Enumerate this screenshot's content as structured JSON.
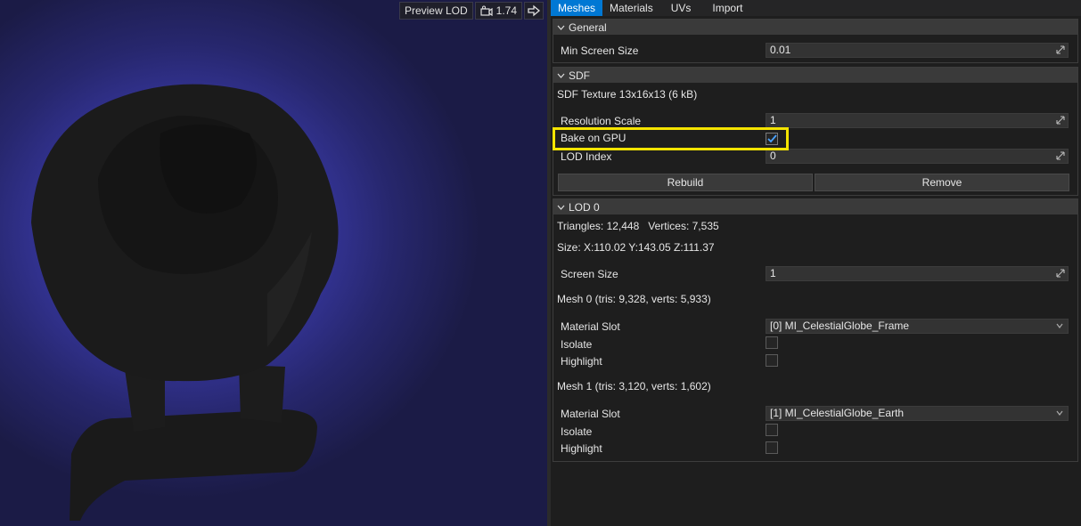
{
  "viewport": {
    "preview_lod_label": "Preview LOD",
    "view_speed": "1.74",
    "colors": {
      "glow": "#3c3cb0",
      "mesh": "#1a1a1a"
    }
  },
  "tabs": [
    {
      "label": "Meshes",
      "active": true
    },
    {
      "label": "Materials",
      "active": false
    },
    {
      "label": "UVs",
      "active": false
    },
    {
      "label": "Import",
      "active": false
    }
  ],
  "general": {
    "title": "General",
    "min_screen_size_label": "Min Screen Size",
    "min_screen_size_value": "0.01"
  },
  "sdf": {
    "title": "SDF",
    "texture_info": "SDF Texture 13x16x13 (6 kB)",
    "resolution_scale_label": "Resolution Scale",
    "resolution_scale_value": "1",
    "bake_on_gpu_label": "Bake on GPU",
    "bake_on_gpu_checked": true,
    "lod_index_label": "LOD Index",
    "lod_index_value": "0",
    "rebuild_label": "Rebuild",
    "remove_label": "Remove"
  },
  "lod0": {
    "title": "LOD 0",
    "triangles_vertices": "Triangles: 12,448   Vertices: 7,535",
    "size": "Size: X:110.02 Y:143.05 Z:111.37",
    "screen_size_label": "Screen Size",
    "screen_size_value": "1",
    "mesh0": {
      "header": "Mesh 0 (tris: 9,328, verts: 5,933)",
      "material_slot_label": "Material Slot",
      "material_slot_value": "[0] MI_CelestialGlobe_Frame",
      "isolate_label": "Isolate",
      "highlight_label": "Highlight"
    },
    "mesh1": {
      "header": "Mesh 1 (tris: 3,120, verts: 1,602)",
      "material_slot_label": "Material Slot",
      "material_slot_value": "[1] MI_CelestialGlobe_Earth",
      "isolate_label": "Isolate",
      "highlight_label": "Highlight"
    }
  },
  "accent_color": "#0078d4",
  "highlight_color": "#f5e400"
}
